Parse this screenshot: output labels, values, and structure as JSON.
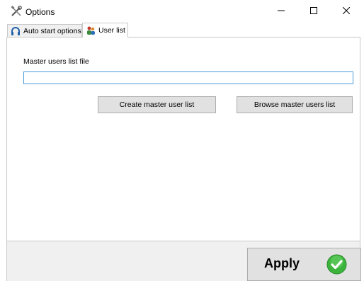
{
  "window": {
    "title": "Options",
    "icon": "tools-icon",
    "controls": {
      "minimize": "minimize-icon",
      "maximize": "maximize-icon",
      "close": "close-icon"
    }
  },
  "tabs": [
    {
      "label": "Auto start options",
      "icon": "headset-icon",
      "active": false
    },
    {
      "label": "User list",
      "icon": "users-icon",
      "active": true
    }
  ],
  "user_list": {
    "master_file_label": "Master users list file",
    "master_file_value": "",
    "create_button": "Create master user list",
    "browse_button": "Browse master users list"
  },
  "footer": {
    "apply_label": "Apply",
    "apply_icon": "check-circle-icon"
  },
  "colors": {
    "focus_border": "#4a9bd8",
    "apply_check": "#3cb43c"
  }
}
